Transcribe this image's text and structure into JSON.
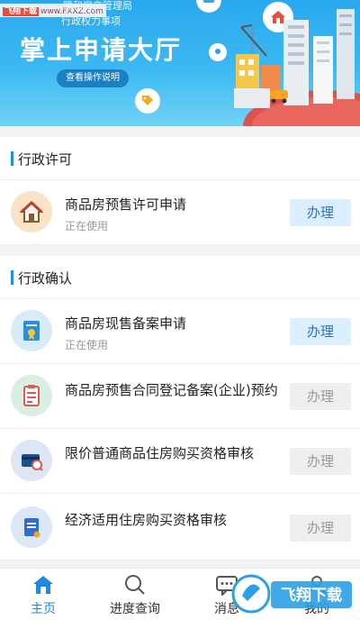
{
  "banner": {
    "watermark_tag": "飞翔下载",
    "watermark_url": "www.FXXZ.com",
    "agency_line1": "障和房产管理局",
    "agency_line2": "行政权力事项",
    "title": "掌上申请大厅",
    "guide_button": "查看操作说明"
  },
  "sections": [
    {
      "title": "行政许可",
      "items": [
        {
          "title": "商品房预售许可申请",
          "status": "正在使用",
          "action": "办理",
          "icon": "house-icon"
        }
      ]
    },
    {
      "title": "行政确认",
      "items": [
        {
          "title": "商品房现售备案申请",
          "status": "正在使用",
          "action": "办理",
          "icon": "certificate-icon"
        },
        {
          "title": "商品房预售合同登记备案(企业)预约",
          "status": "",
          "action": "办理",
          "icon": "clipboard-icon"
        },
        {
          "title": "限价普通商品住房购买资格审核",
          "status": "",
          "action": "办理",
          "icon": "card-search-icon"
        },
        {
          "title": "经济适用住房购买资格审核",
          "status": "",
          "action": "办理",
          "icon": "document-icon"
        }
      ]
    }
  ],
  "tabbar": {
    "tabs": [
      {
        "label": "主页",
        "icon": "home-icon"
      },
      {
        "label": "进度查询",
        "icon": "search-icon"
      },
      {
        "label": "消息",
        "icon": "message-icon"
      },
      {
        "label": "我的",
        "icon": "user-icon"
      }
    ]
  },
  "overlay_logo": "飞翔下载",
  "colors": {
    "accent": "#1e88e5",
    "banner": "#2aa8ee",
    "active_button_bg": "#dcefff"
  }
}
